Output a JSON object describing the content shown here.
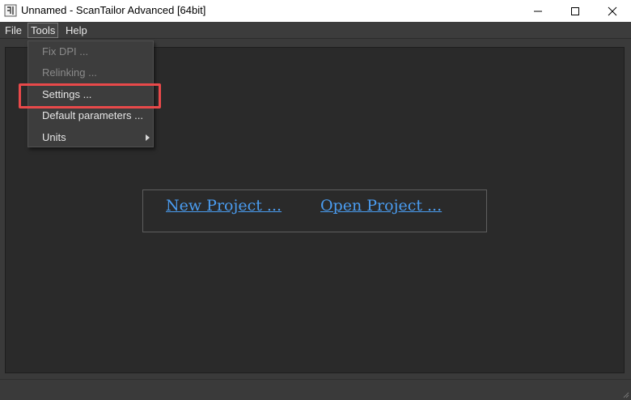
{
  "window": {
    "title": "Unnamed - ScanTailor Advanced [64bit]",
    "app_icon": "scantailor-icon",
    "controls": {
      "minimize": "minimize-icon",
      "maximize": "maximize-icon",
      "close": "close-icon"
    }
  },
  "menubar": {
    "items": [
      {
        "label": "File"
      },
      {
        "label": "Tools"
      },
      {
        "label": "Help"
      }
    ]
  },
  "tools_menu": {
    "items": [
      {
        "label": "Fix DPI ...",
        "enabled": false
      },
      {
        "label": "Relinking ...",
        "enabled": false
      },
      {
        "label": "Settings ...",
        "enabled": true,
        "highlighted": true
      },
      {
        "label": "Default parameters ...",
        "enabled": true
      },
      {
        "label": "Units",
        "enabled": true,
        "submenu": true
      }
    ]
  },
  "welcome": {
    "new_project": "New Project ...",
    "open_project": "Open Project ..."
  },
  "colors": {
    "link": "#4a9cf0",
    "highlight": "#e8494a",
    "background": "#2a2a2a"
  }
}
